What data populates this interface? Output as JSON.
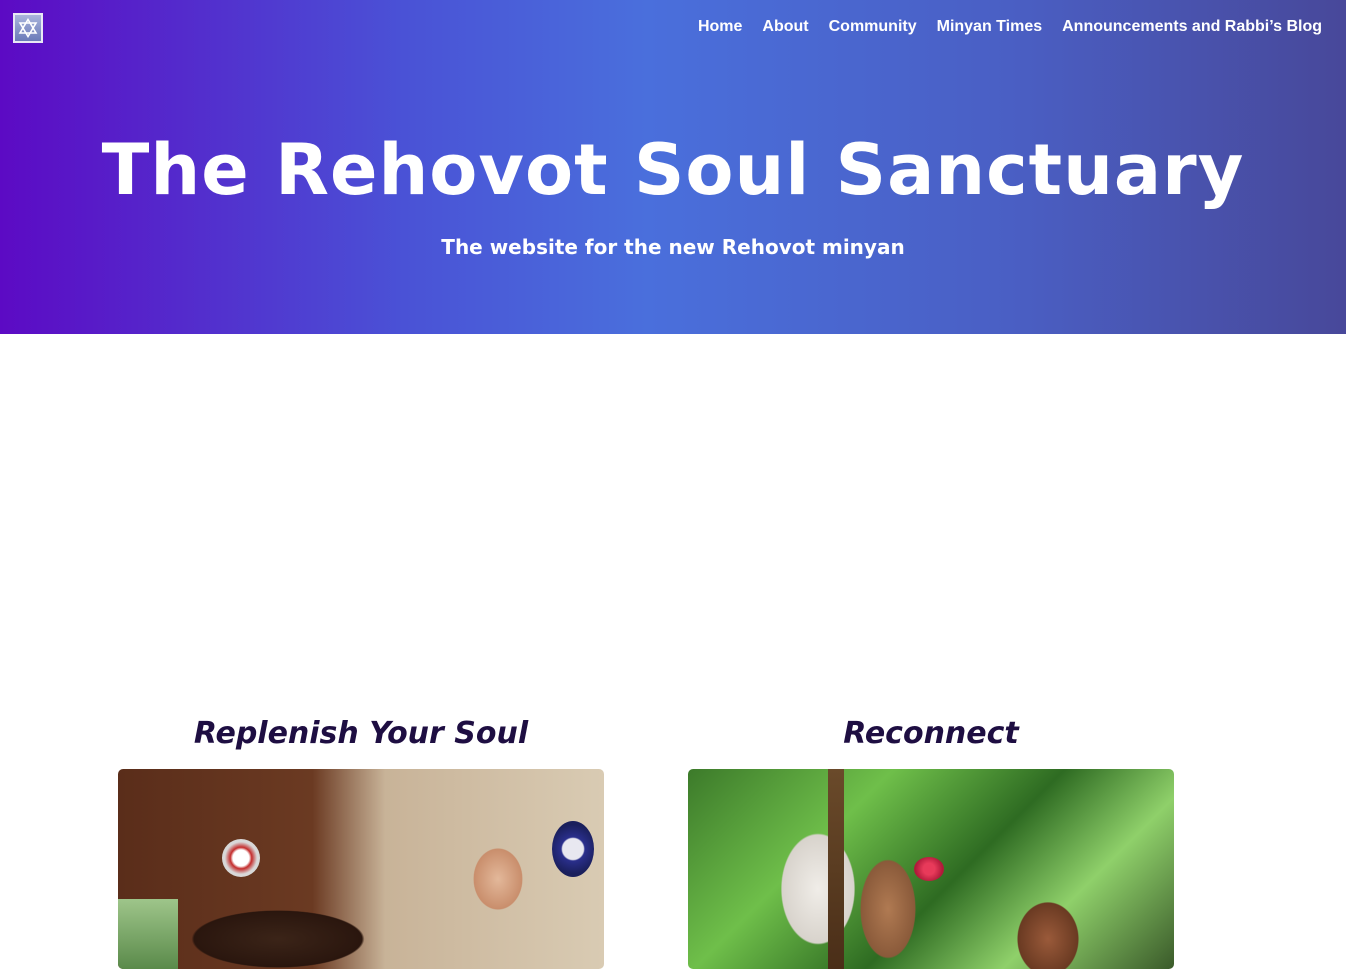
{
  "header": {
    "logo_icon": "star-of-david-icon",
    "nav": [
      {
        "label": "Home"
      },
      {
        "label": "About"
      },
      {
        "label": "Community"
      },
      {
        "label": "Minyan Times"
      },
      {
        "label": "Announcements and Rabbi’s Blog"
      }
    ]
  },
  "hero": {
    "title": "The Rehovot Soul Sanctuary",
    "subtitle": "The website for the new Rehovot minyan",
    "gradient_start": "#5c0ac4",
    "gradient_end": "#48489a"
  },
  "cards": [
    {
      "heading": "Replenish Your Soul",
      "image": "shofar-photo"
    },
    {
      "heading": "Reconnect",
      "image": "rainforest-photo"
    }
  ],
  "colors": {
    "card_heading": "#1e0e42",
    "nav_text": "#ffffff"
  }
}
